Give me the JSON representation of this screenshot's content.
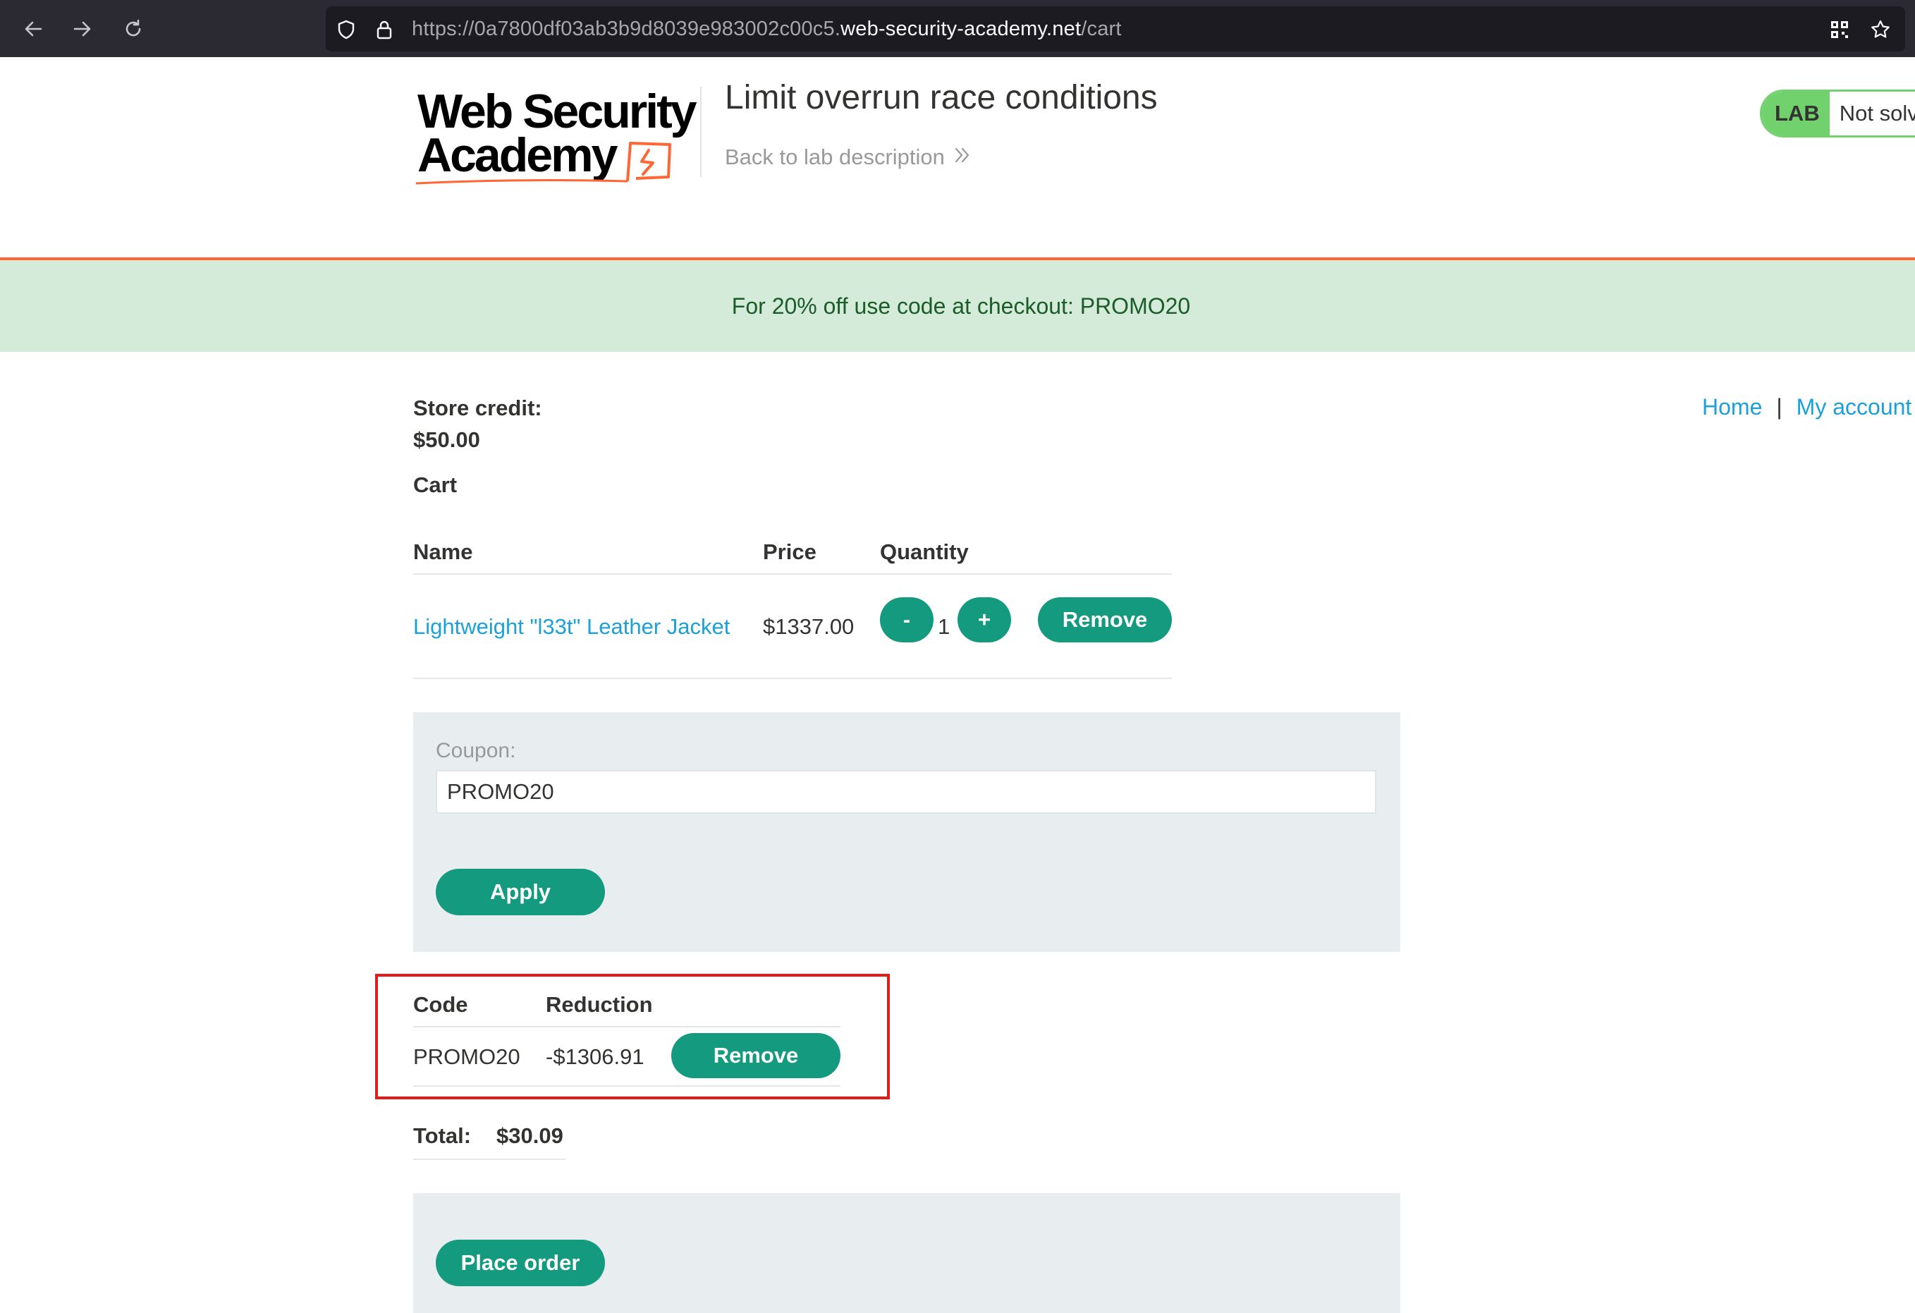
{
  "browser": {
    "url_scheme": "https://",
    "url_subdomain": "0a7800df03ab3b9d8039e983002c00c5.",
    "url_host": "web-security-academy.net",
    "url_path": "/cart"
  },
  "lab": {
    "logo_line1": "Web Security",
    "logo_line2": "Academy",
    "title": "Limit overrun race conditions",
    "back_link": "Back to lab description",
    "badge_label": "LAB",
    "badge_status": "Not solved"
  },
  "promo_banner": "For 20% off use code at checkout: PROMO20",
  "nav": {
    "home": "Home",
    "separator": "|",
    "my_account": "My account"
  },
  "store_credit": {
    "label": "Store credit:",
    "value": "$50.00"
  },
  "cart": {
    "heading": "Cart",
    "columns": [
      "Name",
      "Price",
      "Quantity"
    ],
    "items": [
      {
        "name": "Lightweight \"l33t\" Leather Jacket",
        "price": "$1337.00",
        "quantity": "1",
        "minus_label": "-",
        "plus_label": "+",
        "remove_label": "Remove"
      }
    ]
  },
  "coupon_form": {
    "label": "Coupon:",
    "value": "PROMO20",
    "apply_label": "Apply"
  },
  "applied_coupons": {
    "columns": [
      "Code",
      "Reduction"
    ],
    "rows": [
      {
        "code": "PROMO20",
        "reduction": "-$1306.91",
        "remove_label": "Remove"
      }
    ]
  },
  "total": {
    "label": "Total:",
    "value": "$30.09"
  },
  "order": {
    "place_order_label": "Place order"
  },
  "colors": {
    "accent_button": "#139a7f",
    "link": "#1ba0d9",
    "banner_bg": "#d3ebd8",
    "orange_rule": "#ff6633",
    "highlight_box": "#e41b1b",
    "lab_badge": "#70d16d"
  }
}
